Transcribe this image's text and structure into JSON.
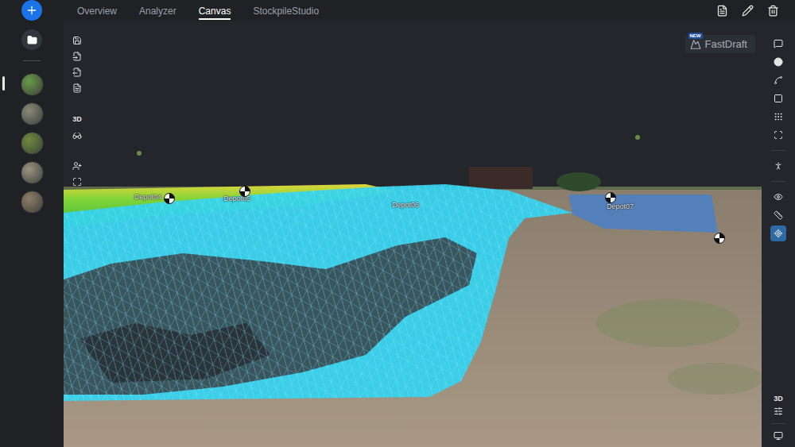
{
  "tabs": [
    {
      "label": "Overview",
      "selected": false
    },
    {
      "label": "Analyzer",
      "selected": false
    },
    {
      "label": "Canvas",
      "selected": true
    },
    {
      "label": "StockpileStudio",
      "selected": false
    }
  ],
  "sidebar": {
    "thumbnails": [
      {
        "selected": true
      },
      {
        "selected": false
      },
      {
        "selected": false
      },
      {
        "selected": false
      },
      {
        "selected": false
      }
    ]
  },
  "fastdraft": {
    "badge": "NEW",
    "label": "FastDraft"
  },
  "left_toolbar": {
    "view_label": "3D"
  },
  "right_toolbar": {
    "tools": [
      {
        "selected": false
      },
      {
        "selected": false
      },
      {
        "selected": false
      },
      {
        "selected": false
      },
      {
        "selected": false
      },
      {
        "selected": false
      },
      {
        "selected": false
      },
      {
        "selected": false
      },
      {
        "selected": false
      },
      {
        "selected": true
      }
    ],
    "view_label": "3D"
  },
  "scene": {
    "labels": [
      "Depot04",
      "Depot05",
      "Depot06",
      "Depot07"
    ]
  }
}
